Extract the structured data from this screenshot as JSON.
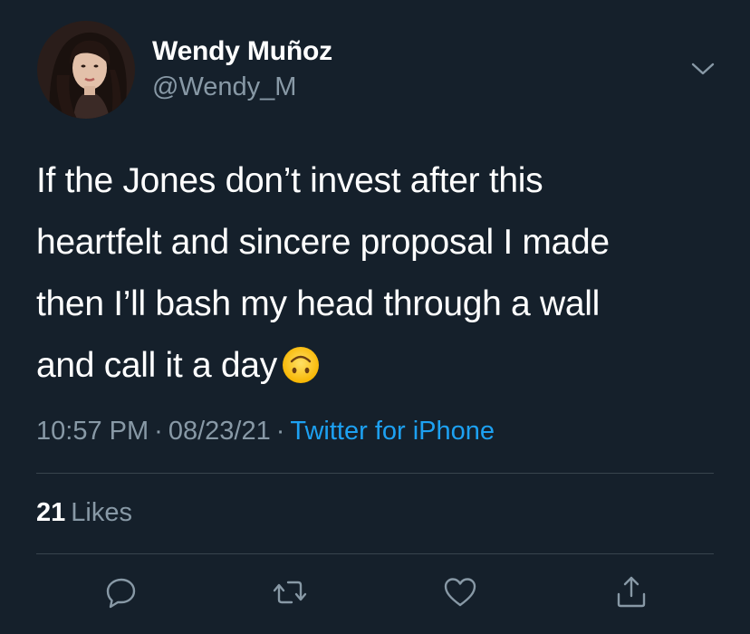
{
  "author": {
    "display_name": "Wendy Muñoz",
    "handle": "@Wendy_M"
  },
  "tweet": {
    "lines": [
      "If the Jones don’t invest after this",
      "heartfelt and sincere proposal I made",
      "then I’ll bash my head through a wall",
      "and call it a day"
    ],
    "emoji": "upside-down-face-emoji"
  },
  "meta": {
    "time": "10:57 PM",
    "separator": "·",
    "date": "08/23/21",
    "source": "Twitter for iPhone"
  },
  "stats": {
    "likes_count": "21",
    "likes_label": "Likes"
  },
  "actions": [
    "reply-icon",
    "retweet-icon",
    "like-icon",
    "share-icon"
  ],
  "colors": {
    "background": "#15202b",
    "primary_text": "#ffffff",
    "secondary_text": "#8899a6",
    "accent": "#1da1f2",
    "divider": "#38444d"
  }
}
